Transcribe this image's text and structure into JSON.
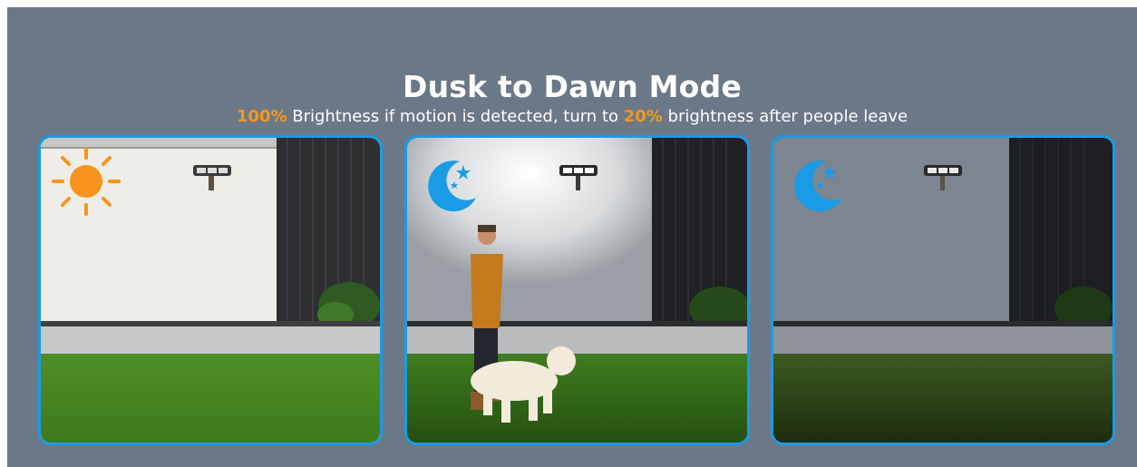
{
  "heading": {
    "title": "Dusk to Dawn Mode",
    "subtitle_parts": {
      "pct_full": "100%",
      "text_mid": " Brightness if motion is detected, turn to ",
      "pct_low": "20%",
      "text_end": " brightness after people leave"
    }
  },
  "colors": {
    "background": "#6b7888",
    "highlight": "#f39a1c",
    "panel_border": "#1a9be6",
    "sun": "#f7941d",
    "moon": "#1a9be6"
  },
  "panels": [
    {
      "scene": "daytime wall with unlit security light",
      "icon": "sun-icon"
    },
    {
      "scene": "night, motion detected, light at full brightness, man walking dog",
      "icon": "moon-stars-icon"
    },
    {
      "scene": "night, no motion, light dimmed",
      "icon": "moon-stars-icon"
    }
  ]
}
